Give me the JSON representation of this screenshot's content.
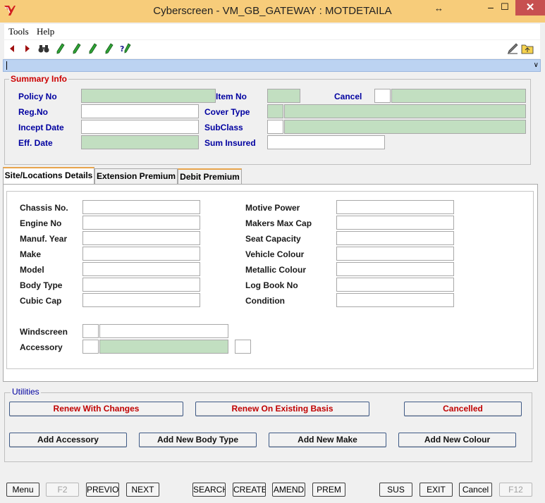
{
  "window": {
    "title": "Cyberscreen - VM_GB_GATEWAY : MOTDETAILA",
    "resize_glyph": "↔",
    "minimize": "–",
    "maximize": "☐",
    "close": "✕"
  },
  "menu": [
    "Tools",
    "Help"
  ],
  "toolbar": {
    "icons": [
      "back-arrow-icon",
      "forward-arrow-icon",
      "binoculars-icon",
      "pen-icon",
      "pen-icon",
      "pen-icon",
      "pen-icon",
      "help-pen-icon",
      "edit-pencil-icon",
      "folder-icon"
    ]
  },
  "summary": {
    "title": "Summary Info",
    "policy_no": "Policy No",
    "reg_no": "Reg.No",
    "incept_date": "Incept Date",
    "eff_date": "Eff. Date",
    "item_no": "Item No",
    "cover_type": "Cover Type",
    "subclass": "SubClass",
    "sum_insured": "Sum Insured",
    "cancel": "Cancel"
  },
  "tabs": [
    "Site/Locations Details",
    "Extension Premium",
    "Debit Premium"
  ],
  "vehicle": {
    "left": [
      "Chassis No.",
      "Engine No",
      "Manuf. Year",
      "Make",
      "Model",
      "Body Type",
      "Cubic Cap"
    ],
    "right": [
      "Motive Power",
      "Makers Max Cap",
      "Seat Capacity",
      "Vehicle Colour",
      "Metallic Colour",
      "Log Book No",
      "Condition"
    ],
    "windscreen": "Windscreen",
    "accessory": "Accessory"
  },
  "utilities": {
    "title": "Utilities",
    "renew_changes": "Renew With Changes",
    "renew_existing": "Renew On Existing Basis",
    "cancelled": "Cancelled",
    "add_accessory": "Add Accessory",
    "add_body_type": "Add New Body Type",
    "add_make": "Add New Make",
    "add_colour": "Add New Colour"
  },
  "footer": {
    "menu": "Menu",
    "f2": "F2",
    "previous": "PREVIO",
    "next": "NEXT",
    "search": "SEARCH",
    "create": "CREATE",
    "amend": "AMEND",
    "prem": "PREM",
    "sus": "SUS",
    "exit": "EXIT",
    "cancel": "Cancel",
    "f12": "F12"
  },
  "colors": {
    "titlebar": "#f7cc7a",
    "readonly_field": "#c2dfc1",
    "label_blue": "#0000a0",
    "accent_red": "#c00000"
  }
}
